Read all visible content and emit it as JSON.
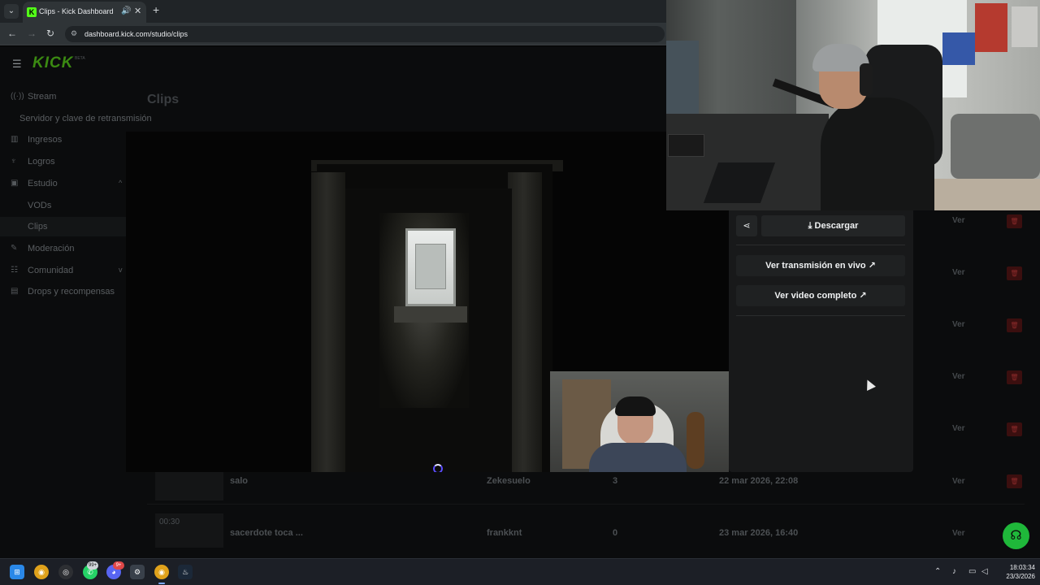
{
  "browser": {
    "tab_title": "Clips - Kick Dashboard",
    "tab_favicon": "K",
    "url": "dashboard.kick.com/studio/clips",
    "icons": [
      "tab-list-icon",
      "audio-icon",
      "close-icon",
      "plus-icon",
      "back-icon",
      "forward-icon",
      "reload-icon",
      "site-info-icon"
    ]
  },
  "sidebar": {
    "logo": "KICK",
    "logo_badge": "BETA",
    "items": [
      {
        "label": "Stream",
        "icon": "broadcast-icon"
      },
      {
        "label": "Servidor y clave de retransmisión"
      },
      {
        "label": "Ingresos",
        "icon": "chart-icon"
      },
      {
        "label": "Logros",
        "icon": "trophy-icon"
      },
      {
        "label": "Estudio",
        "icon": "studio-icon",
        "chevron": "^"
      },
      {
        "label": "VODs"
      },
      {
        "label": "Clips"
      },
      {
        "label": "Moderación",
        "icon": "wrench-icon"
      },
      {
        "label": "Comunidad",
        "icon": "community-icon",
        "chevron": "v"
      },
      {
        "label": "Drops y recompensas",
        "icon": "gift-icon"
      }
    ]
  },
  "main": {
    "title": "Clips"
  },
  "table": {
    "action_label": "Ver",
    "rows": [
      {
        "duration": "",
        "title": "salo",
        "creator": "Zekesuelo",
        "views": "3",
        "date": "22 mar 2026, 22:08"
      },
      {
        "duration": "00:30",
        "title": "sacerdote toca ...",
        "creator": "frankknt",
        "views": "0",
        "date": "23 mar 2026, 16:40"
      }
    ]
  },
  "panel": {
    "download_label": "Descargar",
    "live_link": "Ver transmisión en vivo",
    "full_video_link": "Ver video completo"
  },
  "taskbar": {
    "badges": [
      "99+",
      "9+"
    ],
    "clock_time": "18:03:34",
    "clock_date": "23/3/2026"
  },
  "colors": {
    "kick_green": "#53fc18",
    "delete_red": "#3b0f0f",
    "help_button": "#1fb83a"
  }
}
